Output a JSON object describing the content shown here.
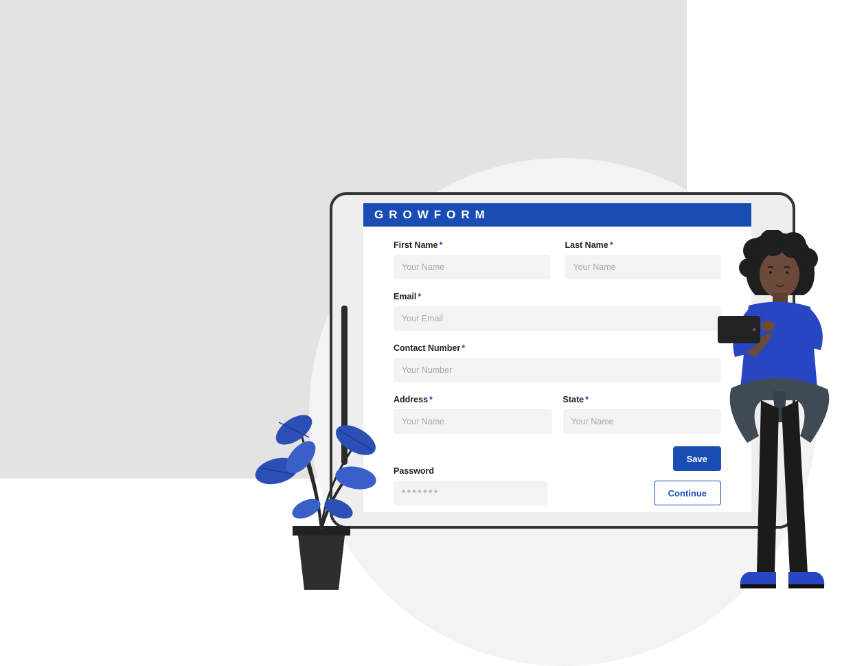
{
  "form": {
    "brand": "GROWFORM",
    "firstName": {
      "label": "First Name",
      "required": "*",
      "placeholder": "Your Name"
    },
    "lastName": {
      "label": "Last Name",
      "required": "*",
      "placeholder": "Your Name"
    },
    "email": {
      "label": "Email",
      "required": "*",
      "placeholder": "Your Email"
    },
    "contact": {
      "label": "Contact  Number",
      "required": "*",
      "placeholder": "Your Number"
    },
    "address": {
      "label": "Address",
      "required": "*",
      "placeholder": "Your Name"
    },
    "state": {
      "label": "State",
      "required": "*",
      "placeholder": "Your Name"
    },
    "password": {
      "label": "Password",
      "placeholder": "*******"
    },
    "buttons": {
      "save": "Save",
      "continue": "Continue"
    }
  },
  "colors": {
    "accent": "#1a4db3"
  }
}
